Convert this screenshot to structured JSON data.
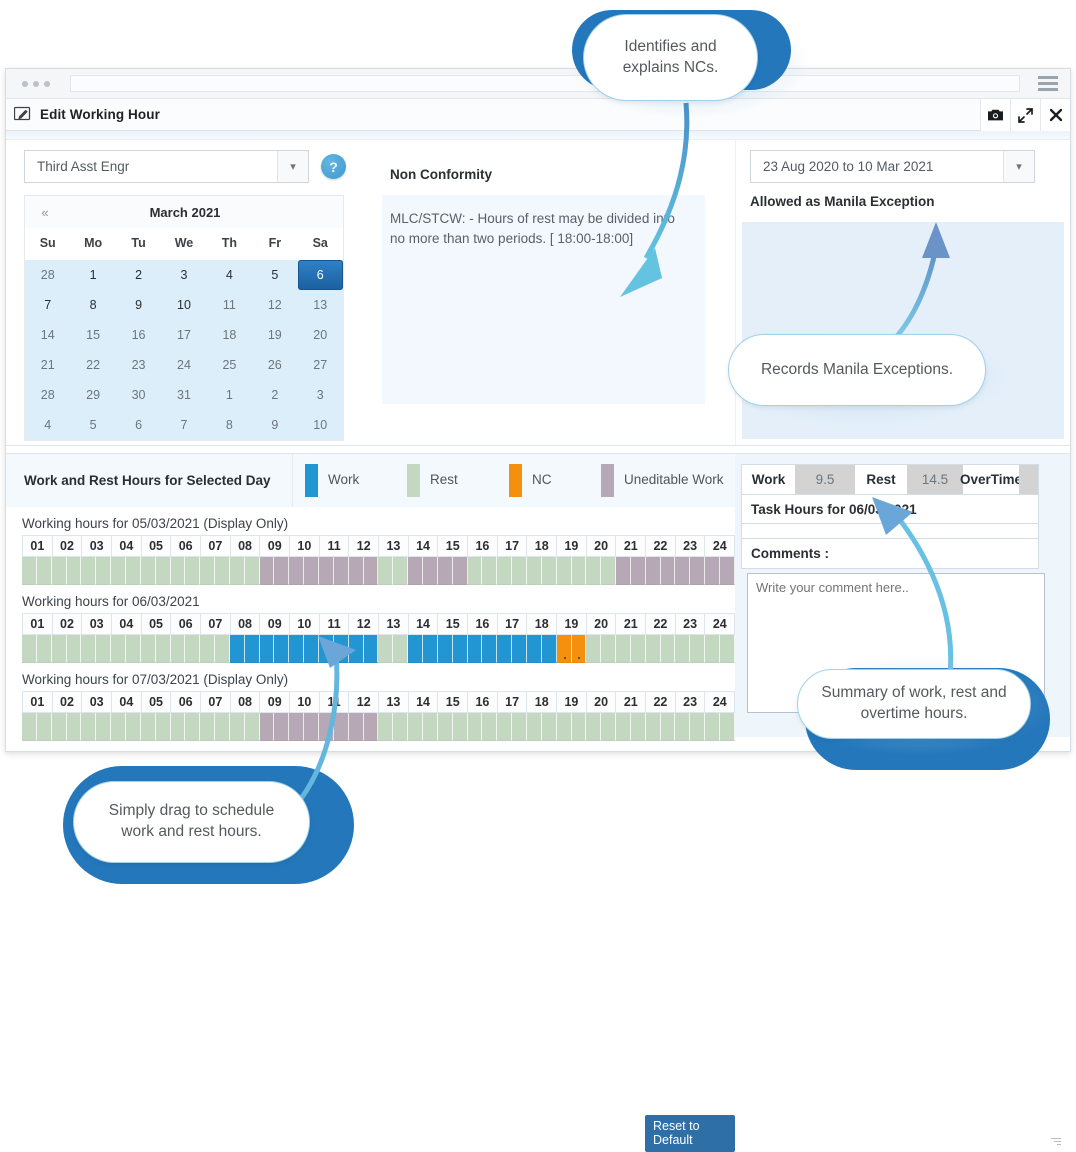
{
  "browser": {
    "omnibox_value": "",
    "menu_icon": "hamburger-icon"
  },
  "titlebar": {
    "edit_icon": "edit-pencil-icon",
    "title": "Edit Working Hour",
    "buttons": [
      {
        "name": "camera-icon",
        "label": ""
      },
      {
        "name": "expand-icon",
        "label": ""
      },
      {
        "name": "close-icon",
        "label": "✕"
      }
    ]
  },
  "toolbar": {
    "rank_select_value": "Third Asst Engr",
    "rank_caret": "chevron-down-icon",
    "help_label": "?",
    "date_range_value": "23 Aug 2020 to 10 Mar 2021",
    "date_caret": "chevron-down-icon"
  },
  "calendar": {
    "prev_label": "«",
    "month_title": "March 2021",
    "dow": [
      "Su",
      "Mo",
      "Tu",
      "We",
      "Th",
      "Fr",
      "Sa"
    ],
    "weeks": [
      [
        {
          "d": "28",
          "mode": "other"
        },
        {
          "d": "1",
          "mode": "cur"
        },
        {
          "d": "2",
          "mode": "cur"
        },
        {
          "d": "3",
          "mode": "cur"
        },
        {
          "d": "4",
          "mode": "cur"
        },
        {
          "d": "5",
          "mode": "cur"
        },
        {
          "d": "6",
          "mode": "sel"
        }
      ],
      [
        {
          "d": "7",
          "mode": "cur"
        },
        {
          "d": "8",
          "mode": "cur"
        },
        {
          "d": "9",
          "mode": "cur"
        },
        {
          "d": "10",
          "mode": "cur"
        },
        {
          "d": "11",
          "mode": "dis"
        },
        {
          "d": "12",
          "mode": "dis"
        },
        {
          "d": "13",
          "mode": "dis"
        }
      ],
      [
        {
          "d": "14",
          "mode": "dis"
        },
        {
          "d": "15",
          "mode": "dis"
        },
        {
          "d": "16",
          "mode": "dis"
        },
        {
          "d": "17",
          "mode": "dis"
        },
        {
          "d": "18",
          "mode": "dis"
        },
        {
          "d": "19",
          "mode": "dis"
        },
        {
          "d": "20",
          "mode": "dis"
        }
      ],
      [
        {
          "d": "21",
          "mode": "dis"
        },
        {
          "d": "22",
          "mode": "dis"
        },
        {
          "d": "23",
          "mode": "dis"
        },
        {
          "d": "24",
          "mode": "dis"
        },
        {
          "d": "25",
          "mode": "dis"
        },
        {
          "d": "26",
          "mode": "dis"
        },
        {
          "d": "27",
          "mode": "dis"
        }
      ],
      [
        {
          "d": "28",
          "mode": "dis"
        },
        {
          "d": "29",
          "mode": "dis"
        },
        {
          "d": "30",
          "mode": "dis"
        },
        {
          "d": "31",
          "mode": "dis"
        },
        {
          "d": "1",
          "mode": "other"
        },
        {
          "d": "2",
          "mode": "other"
        },
        {
          "d": "3",
          "mode": "other"
        }
      ],
      [
        {
          "d": "4",
          "mode": "other"
        },
        {
          "d": "5",
          "mode": "other"
        },
        {
          "d": "6",
          "mode": "other"
        },
        {
          "d": "7",
          "mode": "other"
        },
        {
          "d": "8",
          "mode": "other"
        },
        {
          "d": "9",
          "mode": "other"
        },
        {
          "d": "10",
          "mode": "other"
        }
      ]
    ]
  },
  "non_conformity": {
    "heading": "Non Conformity",
    "text": "MLC/STCW: - Hours of rest may be divided into no more than two periods. [ 18:00-18:00]"
  },
  "manila": {
    "heading": "Allowed as Manila Exception",
    "text": ""
  },
  "work_rest": {
    "section_title": "Work and Rest Hours for Selected Day",
    "legend": [
      {
        "label": "Work",
        "color": "#2196d3"
      },
      {
        "label": "Rest",
        "color": "#c3d7c1"
      },
      {
        "label": "NC",
        "color": "#f5900e"
      },
      {
        "label": "Uneditable Work",
        "color": "#b6a8b4"
      }
    ],
    "hour_labels": [
      "01",
      "02",
      "03",
      "04",
      "05",
      "06",
      "07",
      "08",
      "09",
      "10",
      "11",
      "12",
      "13",
      "14",
      "15",
      "16",
      "17",
      "18",
      "19",
      "20",
      "21",
      "22",
      "23",
      "24"
    ],
    "rows": [
      {
        "label": "Working hours for 05/03/2021 (Display Only)",
        "editable": false,
        "date": "05/03/2021",
        "segments": [
          "rest",
          "rest",
          "rest",
          "rest",
          "rest",
          "rest",
          "rest",
          "rest",
          "unedit",
          "unedit",
          "unedit",
          "unedit",
          "rest",
          "unedit",
          "unedit",
          "rest",
          "rest",
          "rest",
          "rest",
          "rest",
          "unedit",
          "unedit",
          "unedit",
          "unedit"
        ]
      },
      {
        "label": "Working hours for 06/03/2021",
        "editable": true,
        "date": "06/03/2021",
        "segments": [
          "rest",
          "rest",
          "rest",
          "rest",
          "rest",
          "rest",
          "rest",
          "work",
          "work",
          "work",
          "work",
          "work",
          "rest",
          "work",
          "work",
          "work",
          "work",
          "work",
          "nc",
          "rest",
          "rest",
          "rest",
          "rest",
          "rest"
        ]
      },
      {
        "label": "Working hours for 07/03/2021 (Display Only)",
        "editable": false,
        "date": "07/03/2021",
        "segments": [
          "rest",
          "rest",
          "rest",
          "rest",
          "rest",
          "rest",
          "rest",
          "rest",
          "unedit",
          "unedit",
          "unedit",
          "unedit",
          "rest",
          "rest",
          "rest",
          "rest",
          "rest",
          "rest",
          "rest",
          "rest",
          "rest",
          "rest",
          "rest",
          "rest"
        ]
      }
    ],
    "reset_label": "Reset to Default"
  },
  "summary": {
    "work_label": "Work",
    "work_value": "9.5",
    "rest_label": "Rest",
    "rest_value": "14.5",
    "overtime_label": "OverTime",
    "overtime_value": "",
    "task_hours_label": "Task Hours for 06/03/2021",
    "comments_label": "Comments :",
    "comments_value": "",
    "comments_placeholder": "Write your comment here.."
  },
  "callouts": [
    {
      "name": "callout-nc",
      "text": "Identifies and explains NCs."
    },
    {
      "name": "callout-manila",
      "text": "Records Manila Exceptions."
    },
    {
      "name": "callout-summary",
      "text": "Summary of work, rest and overtime hours."
    },
    {
      "name": "callout-drag",
      "text": "Simply drag to schedule work and rest hours."
    }
  ]
}
